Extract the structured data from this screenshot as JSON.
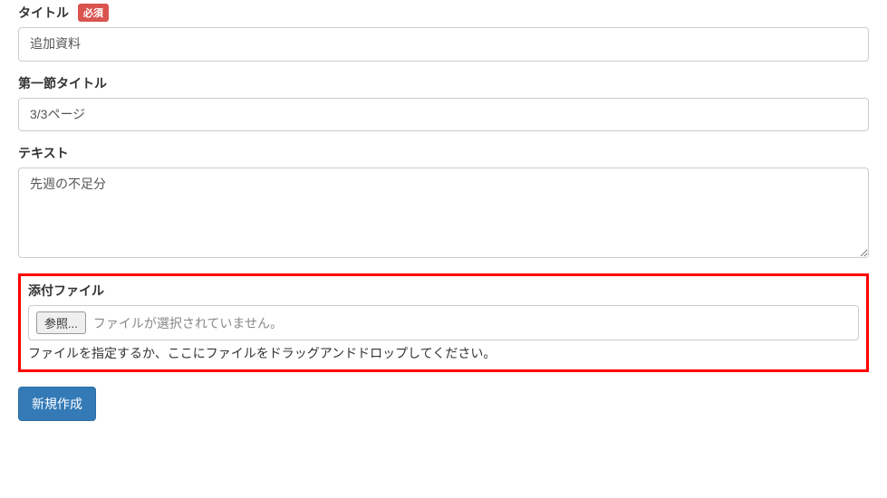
{
  "fields": {
    "title": {
      "label": "タイトル",
      "required_badge": "必須",
      "value": "追加資料"
    },
    "section1_title": {
      "label": "第一節タイトル",
      "value": "3/3ページ"
    },
    "text": {
      "label": "テキスト",
      "value": "先週の不足分"
    },
    "attachment": {
      "label": "添付ファイル",
      "browse_button": "参照...",
      "no_file_text": "ファイルが選択されていません。",
      "help_text": "ファイルを指定するか、ここにファイルをドラッグアンドドロップしてください。"
    }
  },
  "actions": {
    "submit": "新規作成"
  }
}
